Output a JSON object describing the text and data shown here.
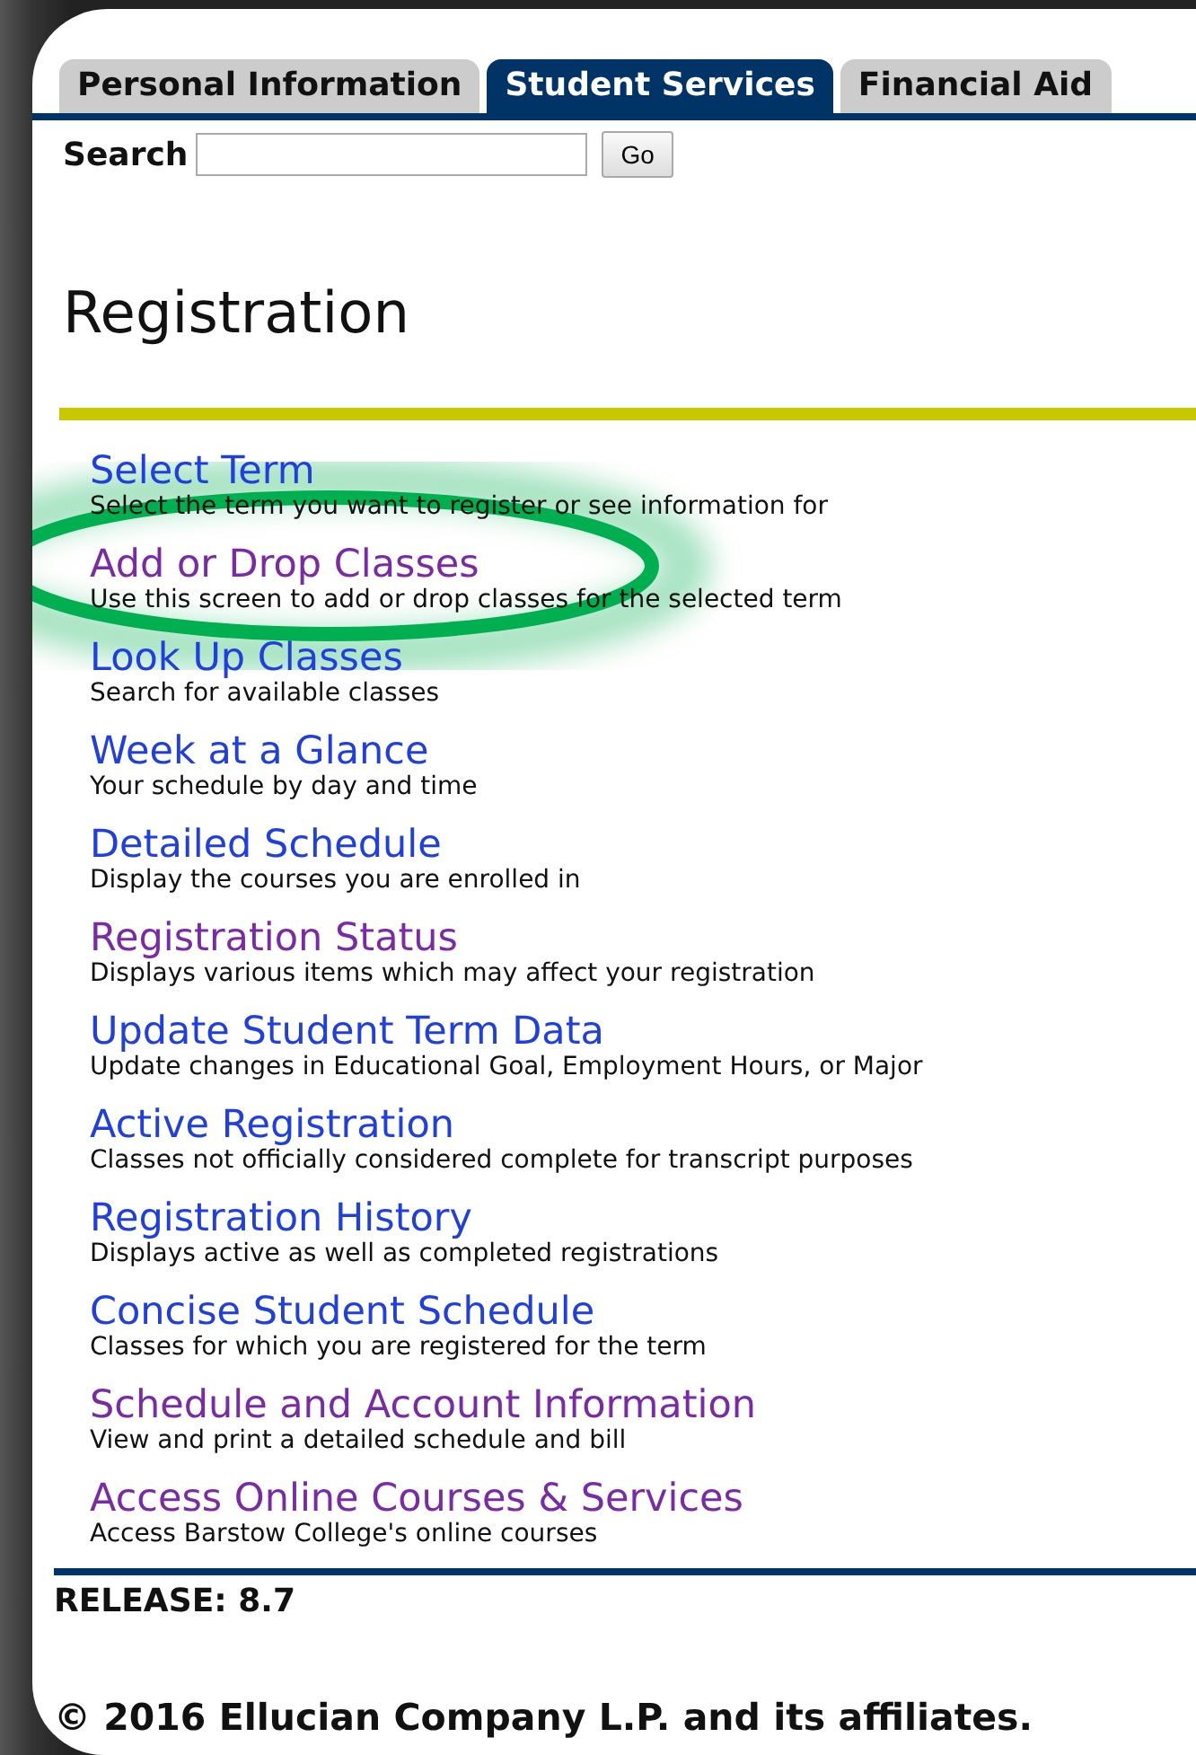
{
  "tabs": [
    {
      "label": "Personal Information",
      "selected": false
    },
    {
      "label": "Student Services",
      "selected": true
    },
    {
      "label": "Financial Aid",
      "selected": false
    }
  ],
  "search": {
    "label": "Search",
    "button": "Go"
  },
  "heading": "Registration",
  "links": [
    {
      "title": "Select Term",
      "description": "Select the term you want to register or see information for",
      "visited": false
    },
    {
      "title": "Add or Drop Classes",
      "description": "Use this screen to add or drop classes for the selected term",
      "visited": true
    },
    {
      "title": "Look Up Classes",
      "description": "Search for available classes",
      "visited": false
    },
    {
      "title": "Week at a Glance",
      "description": "Your schedule by day and time",
      "visited": false
    },
    {
      "title": "Detailed Schedule",
      "description": "Display the courses you are enrolled in",
      "visited": false
    },
    {
      "title": "Registration Status",
      "description": "Displays various items which may affect your registration",
      "visited": true
    },
    {
      "title": "Update Student Term Data",
      "description": "Update changes in Educational Goal, Employment Hours, or Major",
      "visited": false
    },
    {
      "title": "Active Registration",
      "description": "Classes not officially considered complete for transcript purposes",
      "visited": false
    },
    {
      "title": "Registration History",
      "description": "Displays active as well as completed registrations",
      "visited": false
    },
    {
      "title": "Concise Student Schedule",
      "description": "Classes for which you are registered for the term",
      "visited": false
    },
    {
      "title": "Schedule and Account Information",
      "description": "View and print a detailed schedule and bill",
      "visited": true
    },
    {
      "title": "Access Online Courses & Services",
      "description": "Access Barstow College's online courses",
      "visited": true
    }
  ],
  "release": "RELEASE: 8.7",
  "copyright": "© 2016 Ellucian Company L.P. and its affiliates."
}
